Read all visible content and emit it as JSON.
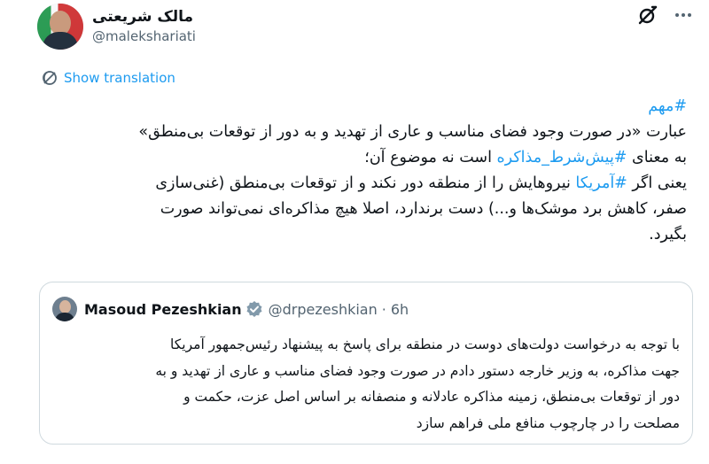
{
  "author": {
    "display_name": "مالک شریعتی",
    "handle": "@malekshariati"
  },
  "translate": {
    "label": "Show translation"
  },
  "tweet": {
    "lines": [
      [
        "#مهم"
      ],
      [
        "عبارت «در صورت وجود فضای مناسب و عاری از تهدید و به دور از توقعات بی‌منطق»"
      ],
      [
        "به معنای ",
        "#پیش‌شرط_مذاکره",
        " است نه موضوع آن؛"
      ],
      [
        "یعنی اگر ",
        "#آمریکا",
        " نیروهایش را از منطقه دور نکند و از توقعات بی‌منطق (غنی‌سازی"
      ],
      [
        "صفر، کاهش برد موشک‌ها و...) دست برندارد، اصلا هیچ مذاکره‌ای نمی‌تواند صورت"
      ],
      [
        "بگیرد."
      ]
    ]
  },
  "quote": {
    "name": "Masoud Pezeshkian",
    "handle": "@drpezeshkian",
    "separator": "·",
    "time": "6h",
    "lines": [
      "با توجه به درخواست دولت‌های دوست در منطقه برای پاسخ به پیشنهاد رئیس‌جمهور آمریکا",
      "جهت مذاکره، به وزیر خارجه دستور دادم در صورت وجود فضای مناسب و عاری از تهدید و به",
      "دور از توقعات بی‌منطق، زمینه مذاکره عادلانه و منصفانه بر اساس اصل عزت، حکمت و",
      "مصلحت را در چارچوب منافع ملی فراهم سازد"
    ]
  },
  "icons": {
    "grok": "grok-icon",
    "more": "more-icon",
    "translate": "globe-icon",
    "verified": "verified-badge-icon"
  },
  "colors": {
    "link": "#1d9bf0",
    "muted": "#536471",
    "border": "#cfd9de",
    "text": "#0f1419"
  }
}
